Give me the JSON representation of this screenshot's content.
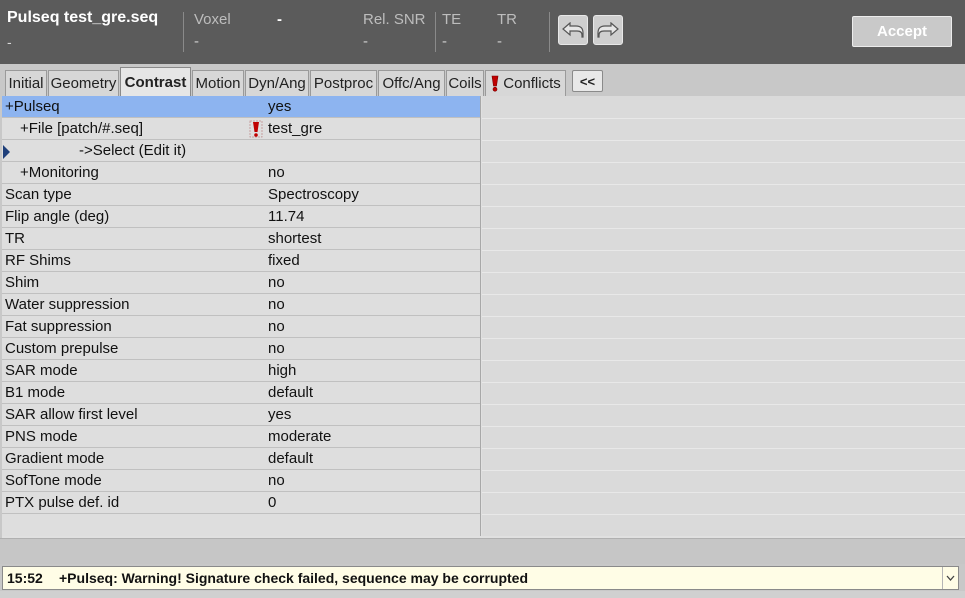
{
  "header": {
    "title": "Pulseq test_gre.seq",
    "title_sub": "-",
    "voxel_label": "Voxel",
    "voxel_value": "-",
    "voxel_sub": "-",
    "snr_label": "Rel. SNR",
    "snr_sub": "-",
    "te_label": "TE",
    "te_sub": "-",
    "tr_label": "TR",
    "tr_sub": "-",
    "undo_icon": "undo-arrow-icon",
    "redo_icon": "redo-arrow-icon",
    "accept_label": "Accept"
  },
  "tabs": [
    {
      "label": "Initial",
      "active": false
    },
    {
      "label": "Geometry",
      "active": false
    },
    {
      "label": "Contrast",
      "active": true
    },
    {
      "label": "Motion",
      "active": false
    },
    {
      "label": "Dyn/Ang",
      "active": false
    },
    {
      "label": "Postproc",
      "active": false
    },
    {
      "label": "Offc/Ang",
      "active": false
    },
    {
      "label": "Coils",
      "active": false
    },
    {
      "label": "Conflicts",
      "active": false,
      "icon": "warning-icon"
    }
  ],
  "collapse_label": "<<",
  "params": [
    {
      "label": "+Pulseq",
      "value": "yes"
    },
    {
      "label": "+File [patch/#.seq]",
      "value": "test_gre"
    },
    {
      "label": "->Select (Edit it)",
      "value": ""
    },
    {
      "label": "+Monitoring",
      "value": "no"
    },
    {
      "label": "Scan type",
      "value": "Spectroscopy"
    },
    {
      "label": "Flip angle (deg)",
      "value": "11.74"
    },
    {
      "label": "TR",
      "value": "shortest"
    },
    {
      "label": "RF Shims",
      "value": "fixed"
    },
    {
      "label": "Shim",
      "value": "no"
    },
    {
      "label": "Water suppression",
      "value": "no"
    },
    {
      "label": "Fat suppression",
      "value": "no"
    },
    {
      "label": "Custom prepulse",
      "value": "no"
    },
    {
      "label": "SAR mode",
      "value": "high"
    },
    {
      "label": "B1 mode",
      "value": "default"
    },
    {
      "label": "SAR allow first level",
      "value": "yes"
    },
    {
      "label": "PNS mode",
      "value": "moderate"
    },
    {
      "label": "Gradient mode",
      "value": "default"
    },
    {
      "label": "SofTone mode",
      "value": "no"
    },
    {
      "label": "PTX pulse def. id",
      "value": "0"
    }
  ],
  "status": {
    "time": "15:52",
    "message": "+Pulseq: Warning! Signature check failed, sequence may be corrupted"
  },
  "colors": {
    "header_bg": "#5b5b5b",
    "selected_row": "#8db4f0",
    "warning": "#c00000",
    "status_bg": "#fffde6"
  }
}
